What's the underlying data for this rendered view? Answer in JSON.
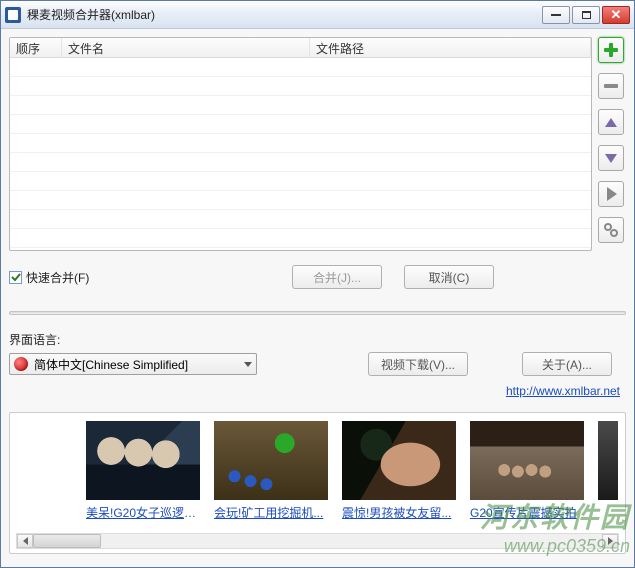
{
  "window": {
    "title": "稞麦视频合并器(xmlbar)"
  },
  "table": {
    "columns": {
      "order": "顺序",
      "filename": "文件名",
      "filepath": "文件路径"
    }
  },
  "sidebar_buttons": {
    "add": "add",
    "remove": "remove",
    "up": "up",
    "down": "down",
    "play": "play",
    "settings": "settings"
  },
  "fast_merge": {
    "label": "快速合并(F)",
    "checked": true
  },
  "buttons": {
    "merge": "合并(J)...",
    "cancel": "取消(C)",
    "download": "视频下载(V)...",
    "about": "关于(A)..."
  },
  "language": {
    "label": "界面语言:",
    "selected": "简体中文[Chinese Simplified]"
  },
  "link": {
    "text": "http://www.xmlbar.net"
  },
  "thumbs": [
    {
      "caption": "美呆!G20女子巡逻队..."
    },
    {
      "caption": "会玩!矿工用挖掘机..."
    },
    {
      "caption": "震惊!男孩被女友留..."
    },
    {
      "caption": "G20宣传片震撼实拍"
    }
  ],
  "watermark": {
    "line1": "河东软件园",
    "line2": "www.pc0359.cn"
  }
}
